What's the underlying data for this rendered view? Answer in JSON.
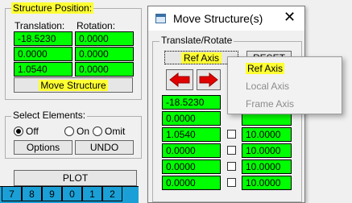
{
  "structure_panel": {
    "title": "Structure Position:",
    "translation_label": "Translation:",
    "rotation_label": "Rotation:",
    "translation": [
      "-18.5230",
      "0.0000",
      "1.0540"
    ],
    "rotation": [
      "0.0000",
      "0.0000",
      "0.0000"
    ],
    "move_button": "Move Structure"
  },
  "select_panel": {
    "title": "Select Elements:",
    "options": [
      "Off",
      "On",
      "Omit"
    ],
    "selected": "Off",
    "options_button": "Options",
    "undo_button": "UNDO"
  },
  "plot_button": "PLOT",
  "keys": [
    "7",
    "8",
    "9",
    "0",
    "1",
    "2"
  ],
  "dialog": {
    "title": "Move Structure(s)",
    "group_title": "Translate/Rotate",
    "ref_axis_button": "Ref Axis",
    "reset_button": "RESET",
    "left_values": [
      "-18.5230",
      "0.0000",
      "1.0540",
      "0.0000",
      "0.0000",
      "0.0000"
    ],
    "right_values": [
      "",
      "",
      "10.0000",
      "10.0000",
      "10.0000",
      "10.0000"
    ]
  },
  "menu": {
    "items": [
      "Ref Axis",
      "Local Axis",
      "Frame Axis"
    ],
    "active": "Ref Axis"
  },
  "colors": {
    "field_green": "#00ff00",
    "highlight": "#ffff33",
    "arrow_red": "#e00000",
    "key_blue": "#1aa0d6"
  }
}
